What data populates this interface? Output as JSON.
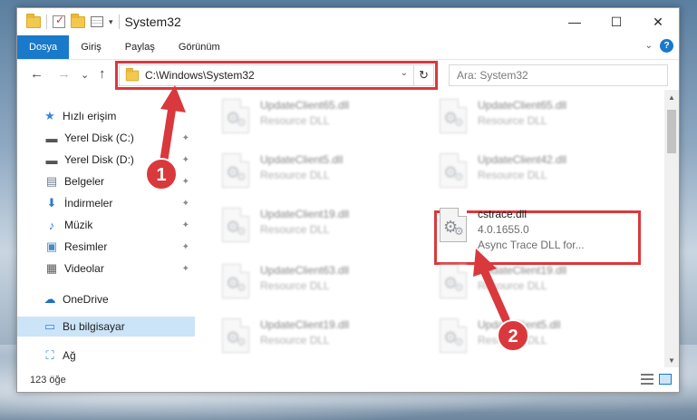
{
  "window": {
    "title": "System32",
    "controls": {
      "minimize": "—",
      "maximize": "☐",
      "close": "✕"
    }
  },
  "ribbon": {
    "tabs": [
      "Dosya",
      "Giriş",
      "Paylaş",
      "Görünüm"
    ],
    "active_tab": "Dosya",
    "expand": "⌄",
    "help": "?"
  },
  "nav": {
    "back": "←",
    "forward": "→",
    "recent": "⌄",
    "up": "↑",
    "address": "C:\\Windows\\System32",
    "address_dropdown": "⌄",
    "refresh": "↻",
    "search_placeholder": "Ara: System32"
  },
  "sidebar": {
    "items": [
      {
        "label": "Hızlı erişim",
        "icon": "star-icon",
        "glyph": "★",
        "color": "#3a86d4",
        "pinned": false,
        "selected": false
      },
      {
        "label": "Yerel Disk (C:)",
        "icon": "drive-icon",
        "glyph": "▬",
        "color": "#555555",
        "pinned": true,
        "selected": false
      },
      {
        "label": "Yerel Disk (D:)",
        "icon": "drive-icon",
        "glyph": "▬",
        "color": "#555555",
        "pinned": true,
        "selected": false
      },
      {
        "label": "Belgeler",
        "icon": "documents-icon",
        "glyph": "▤",
        "color": "#6b7c8f",
        "pinned": true,
        "selected": false
      },
      {
        "label": "İndirmeler",
        "icon": "downloads-icon",
        "glyph": "⬇",
        "color": "#2f7dd1",
        "pinned": true,
        "selected": false
      },
      {
        "label": "Müzik",
        "icon": "music-icon",
        "glyph": "♪",
        "color": "#2f7dd1",
        "pinned": true,
        "selected": false
      },
      {
        "label": "Resimler",
        "icon": "pictures-icon",
        "glyph": "▣",
        "color": "#4a8ac4",
        "pinned": true,
        "selected": false
      },
      {
        "label": "Videolar",
        "icon": "videos-icon",
        "glyph": "▦",
        "color": "#5b5b5b",
        "pinned": true,
        "selected": false
      },
      {
        "label": "OneDrive",
        "icon": "cloud-icon",
        "glyph": "☁",
        "color": "#1f6fc4",
        "pinned": false,
        "selected": false
      },
      {
        "label": "Bu bilgisayar",
        "icon": "computer-icon",
        "glyph": "▭",
        "color": "#3a86d4",
        "pinned": false,
        "selected": true
      },
      {
        "label": "Ağ",
        "icon": "network-icon",
        "glyph": "⛶",
        "color": "#3a86d4",
        "pinned": false,
        "selected": false
      }
    ],
    "pin_glyph": "📌"
  },
  "files": [
    {
      "name": "UpdateClient65.dll",
      "type": "Resource DLL",
      "blurred": true
    },
    {
      "name": "UpdateClient65.dll",
      "type": "Resource DLL",
      "blurred": true
    },
    {
      "name": "UpdateClient5.dll",
      "type": "Resource DLL",
      "blurred": true
    },
    {
      "name": "UpdateClient42.dll",
      "type": "Resource DLL",
      "blurred": true
    },
    {
      "name": "UpdateClient19.dll",
      "type": "Resource DLL",
      "blurred": true
    },
    {
      "name": "cstrace.dll",
      "version": "4.0.1655.0",
      "type": "Async Trace DLL for...",
      "blurred": false
    },
    {
      "name": "UpdateClient63.dll",
      "type": "Resource DLL",
      "blurred": true
    },
    {
      "name": "UpdateClient19.dll",
      "type": "Resource DLL",
      "blurred": true
    },
    {
      "name": "UpdateClient19.dll",
      "type": "Resource DLL",
      "blurred": true
    },
    {
      "name": "UpdateClient5.dll",
      "type": "Resource DLL",
      "blurred": true
    }
  ],
  "status": {
    "item_count": "123 öğe"
  },
  "annotations": {
    "step1": "1",
    "step2": "2",
    "color": "#d9393c"
  }
}
